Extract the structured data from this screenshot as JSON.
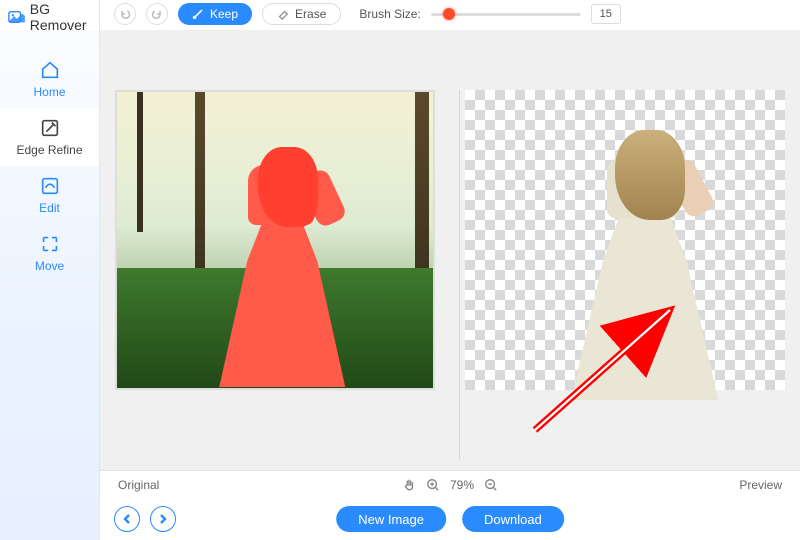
{
  "app": {
    "name": "BG Remover"
  },
  "sidebar": {
    "items": [
      {
        "label": "Home"
      },
      {
        "label": "Edge Refine"
      },
      {
        "label": "Edit"
      },
      {
        "label": "Move"
      }
    ],
    "active_index": 1
  },
  "toolbar": {
    "keep_label": "Keep",
    "erase_label": "Erase",
    "brush_label": "Brush Size:",
    "brush_value": "15"
  },
  "status": {
    "left_label": "Original",
    "zoom_percent": "79%",
    "right_label": "Preview"
  },
  "bottom": {
    "new_image_label": "New Image",
    "download_label": "Download"
  },
  "colors": {
    "accent": "#2a8bff",
    "brush_indicator": "#ff4d2a",
    "annotation_arrow": "#ff0000"
  }
}
